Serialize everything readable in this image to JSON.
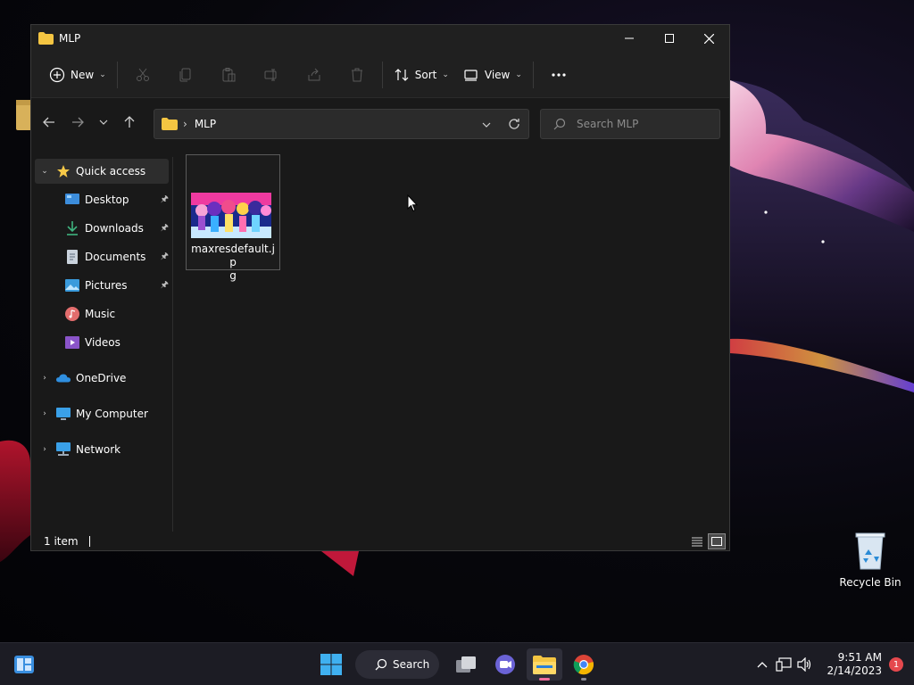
{
  "window": {
    "title": "MLP",
    "folder_icon": "folder-icon",
    "controls": [
      "minimize-icon",
      "maximize-icon",
      "close-icon"
    ]
  },
  "commandbar": {
    "new_label": "New",
    "sort_label": "Sort",
    "view_label": "View",
    "disabled_icons": [
      "cut-icon",
      "copy-icon",
      "paste-icon",
      "rename-icon",
      "share-icon",
      "delete-icon"
    ]
  },
  "addressbar": {
    "path": "MLP",
    "search_placeholder": "Search MLP"
  },
  "navpane": {
    "quick_access": "Quick access",
    "items": [
      {
        "label": "Desktop",
        "icon": "desktop-icon",
        "pinned": true
      },
      {
        "label": "Downloads",
        "icon": "download-icon",
        "pinned": true
      },
      {
        "label": "Documents",
        "icon": "documents-icon",
        "pinned": true
      },
      {
        "label": "Pictures",
        "icon": "pictures-icon",
        "pinned": true
      },
      {
        "label": "Music",
        "icon": "music-icon",
        "pinned": false
      },
      {
        "label": "Videos",
        "icon": "videos-icon",
        "pinned": false
      }
    ],
    "roots": [
      {
        "label": "OneDrive",
        "icon": "onedrive-icon"
      },
      {
        "label": "My Computer",
        "icon": "computer-icon"
      },
      {
        "label": "Network",
        "icon": "network-icon"
      }
    ]
  },
  "files": [
    {
      "name": "maxresdefault.jpg",
      "name_line1": "maxresdefault.jp",
      "name_line2": "g"
    }
  ],
  "statusbar": {
    "count_text": "1 item"
  },
  "desktop": {
    "recycle_bin_label": "Recycle Bin"
  },
  "taskbar": {
    "search_label": "Search",
    "apps": [
      "task-view-icon",
      "teams-chat-icon",
      "file-explorer-icon",
      "chrome-icon"
    ],
    "time": "9:51 AM",
    "date": "2/14/2023",
    "notification_count": "1"
  },
  "colors": {
    "window_bg": "#191919",
    "chrome_bg": "#202020",
    "taskbar_bg": "#1c1c24",
    "accent": "#0078d4",
    "folder_yellow": "#f4c542"
  }
}
